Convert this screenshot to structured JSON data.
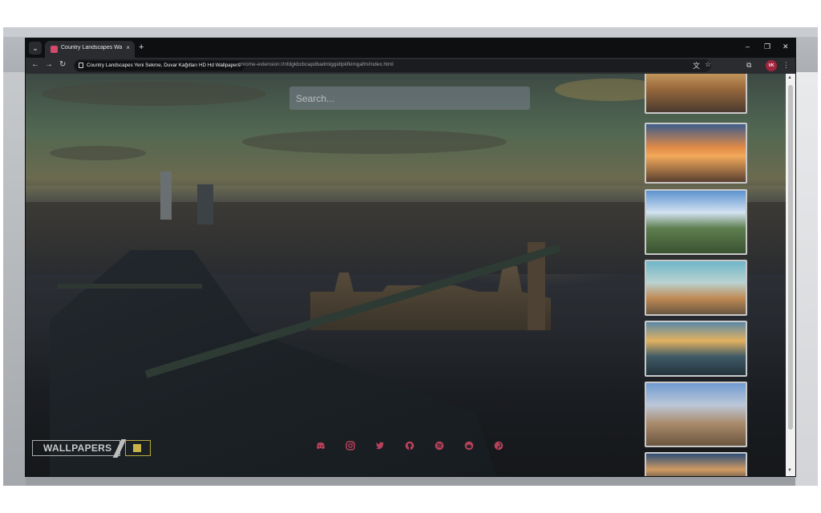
{
  "browser": {
    "tab_title": "Country Landscapes Wallpaper",
    "tab_close": "×",
    "new_tab": "+",
    "tab_list": "⌄",
    "minimize": "–",
    "restore": "❐",
    "close": "✕",
    "back": "←",
    "forward": "→",
    "reload": "↻",
    "site_chip": "Country Landscapes Yeni Sekme, Duvar Kağıtları HD Hd Wallpapers",
    "url": "chrome-extension://nfdgkbcbcapdbadmlggidlpkfkimgafm/index.html",
    "translate_icon": "文",
    "bookmark_icon": "☆",
    "extensions_icon": "⧉",
    "avatar": "VK",
    "menu_icon": "⋮"
  },
  "page": {
    "search_placeholder": "Search...",
    "logo_text": "WALLPAPERS"
  },
  "social": [
    {
      "icon": "discord-icon",
      "color": "#b8405a"
    },
    {
      "icon": "instagram-icon",
      "color": "#b8405a"
    },
    {
      "icon": "twitter-icon",
      "color": "#b8405a"
    },
    {
      "icon": "github-icon",
      "color": "#b8405a"
    },
    {
      "icon": "spotify-icon",
      "color": "#b8405a"
    },
    {
      "icon": "reddit-icon",
      "color": "#b8405a"
    },
    {
      "icon": "pinterest-icon",
      "color": "#b8405a"
    }
  ],
  "gallery": [
    {
      "name": "city-skyline-dusk"
    },
    {
      "name": "empire-state-sunset"
    },
    {
      "name": "mountain-valley"
    },
    {
      "name": "london-big-ben"
    },
    {
      "name": "river-city-sunset"
    },
    {
      "name": "balloons-cappadocia"
    },
    {
      "name": "lake-sunset"
    }
  ],
  "colors": {
    "accent": "#b8405a",
    "tab_bar": "#0e0f11",
    "toolbar": "#2b2c30"
  }
}
